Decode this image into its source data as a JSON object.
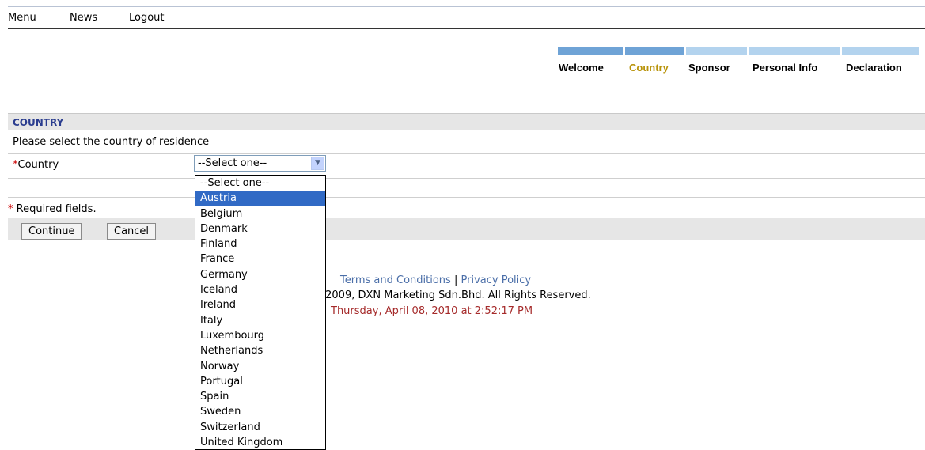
{
  "nav": {
    "menu": "Menu",
    "news": "News",
    "logout": "Logout"
  },
  "steps": [
    {
      "label": "Welcome",
      "state": "done"
    },
    {
      "label": "Country",
      "state": "active"
    },
    {
      "label": "Sponsor",
      "state": "pending"
    },
    {
      "label": "Personal Info",
      "state": "pending"
    },
    {
      "label": "Declaration",
      "state": "pending"
    }
  ],
  "form": {
    "section_title": "COUNTRY",
    "description": "Please select the country of residence",
    "country_star": "*",
    "country_label": "Country",
    "select_value": "--Select one--",
    "required_star": "*",
    "required_note": " Required fields.",
    "continue_label": "Continue",
    "cancel_label": "Cancel"
  },
  "dropdown": {
    "options": [
      "--Select one--",
      "Austria",
      "Belgium",
      "Denmark",
      "Finland",
      "France",
      "Germany",
      "Iceland",
      "Ireland",
      "Italy",
      "Luxembourg",
      "Netherlands",
      "Norway",
      "Portugal",
      "Spain",
      "Sweden",
      "Switzerland",
      "United Kingdom"
    ],
    "highlighted": "Austria"
  },
  "footer": {
    "terms": "Terms and Conditions",
    "separator": "|",
    "privacy": "Privacy Policy",
    "copyright": "© 2009, DXN Marketing Sdn.Bhd. All Rights Reserved.",
    "datetime": "Thursday, April 08, 2010  at  2:52:17 PM"
  },
  "colors": {
    "section_title": "#2b3d8f",
    "active_step": "#b8930a",
    "required": "#cc0000",
    "highlight": "#316ac5",
    "datetime": "#a52a2a"
  }
}
